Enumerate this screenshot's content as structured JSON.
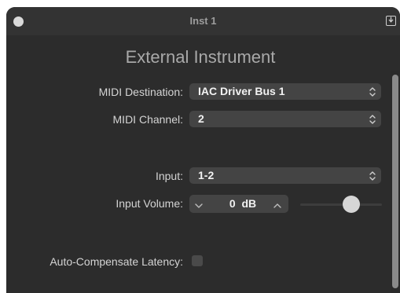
{
  "window": {
    "title": "Inst 1"
  },
  "plugin": {
    "title": "External Instrument"
  },
  "midi_destination": {
    "label": "MIDI Destination:",
    "value": "IAC Driver Bus 1"
  },
  "midi_channel": {
    "label": "MIDI Channel:",
    "value": "2"
  },
  "input": {
    "label": "Input:",
    "value": "1-2"
  },
  "input_volume": {
    "label": "Input Volume:",
    "value": "0  dB",
    "slider_level_fraction": 0.62
  },
  "auto_compensate": {
    "label": "Auto-Compensate Latency:",
    "checked": false
  },
  "icons": {
    "window_close": "circle-icon",
    "download": "download-icon",
    "popup_arrows": "updown-chevron-icon",
    "stepper_down": "chevron-down-icon",
    "stepper_up": "chevron-up-icon"
  },
  "colors": {
    "window_bg": "#2c2c2c",
    "titlebar_bg": "#333333",
    "control_bg": "#444444",
    "label_text": "#d4d4d4",
    "value_text": "#f2f2f2"
  }
}
